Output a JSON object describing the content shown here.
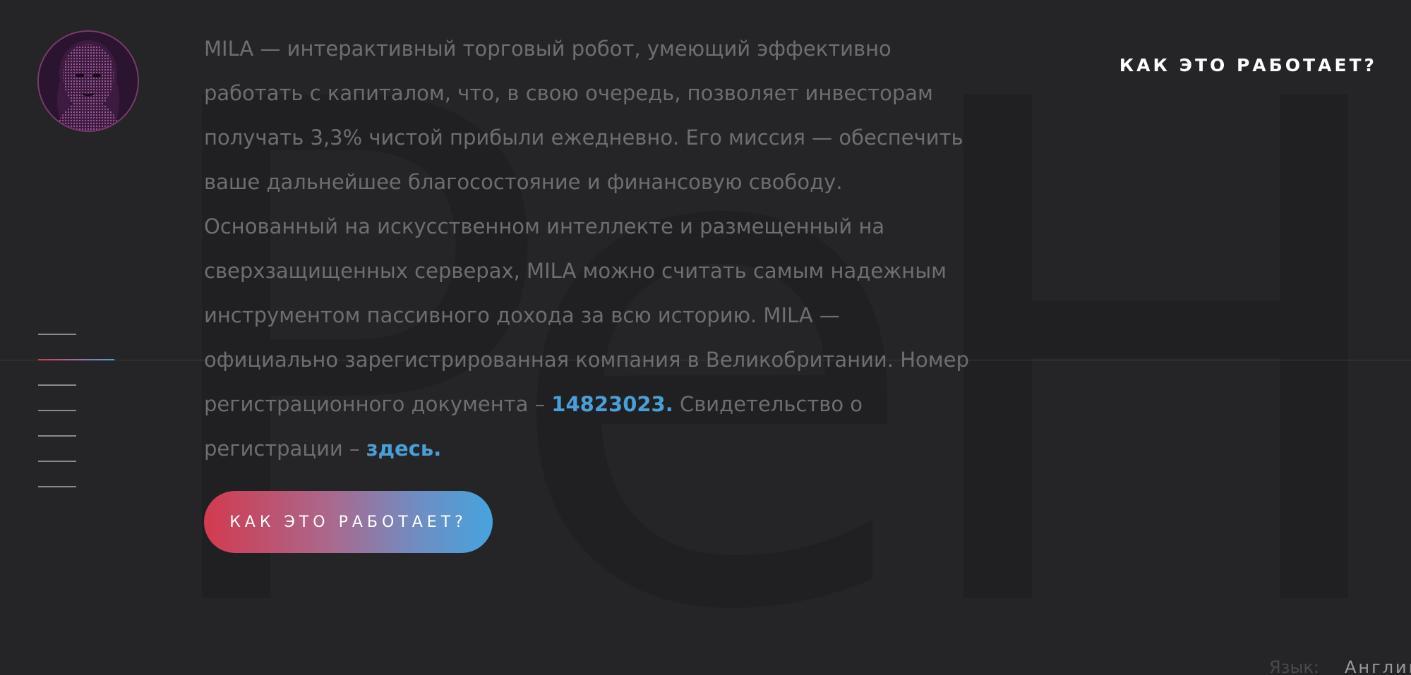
{
  "background_letters": "PeH",
  "header": {
    "nav_link": "КАК ЭТО РАБОТАЕТ?"
  },
  "avatar": {
    "icon": "robot-woman-avatar",
    "border_color": "#7d3a6e"
  },
  "side_nav": {
    "item_count": 7,
    "active_index": 1
  },
  "about": {
    "paragraph": "MILA — интерактивный торговый робот, умеющий эффективно работать с капиталом, что, в свою очередь, позволяет инвесторам получать 3,3% чистой прибыли ежедневно. Его миссия — обеспечить ваше дальнейшее благосостояние и финансовую свободу. Основанный на искусственном интеллекте и размещенный на сверхзащищенных серверах, MILA можно считать самым надежным инструментом пассивного дохода за всю историю. MILA — официально зарегистрированная компания в Великобритании. Номер регистрационного документа – ",
    "registration_number": "14823023.",
    "certificate_prefix": " Свидетельство о регистрации – ",
    "certificate_link": "здесь."
  },
  "cta": {
    "label": "КАК ЭТО РАБОТАЕТ?"
  },
  "language": {
    "label": "Язык:",
    "value": "Англий"
  },
  "colors": {
    "background": "#252527",
    "link": "#4a9fd8",
    "gradient_start": "#d33a4f",
    "gradient_end": "#47a3dd"
  }
}
